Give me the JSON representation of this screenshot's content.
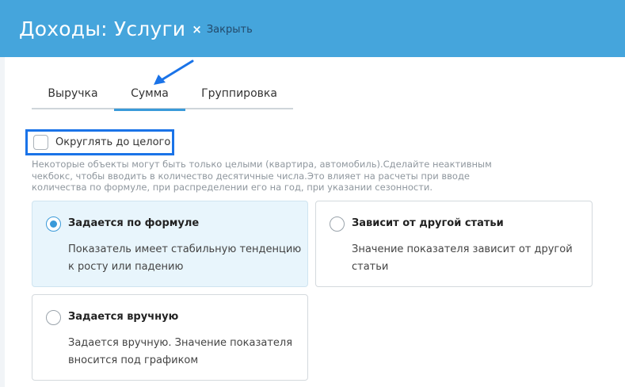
{
  "header": {
    "title": "Доходы: Услуги",
    "close_label": "Закрыть"
  },
  "tabs": [
    {
      "label": "Выручка",
      "active": false
    },
    {
      "label": "Сумма",
      "active": true
    },
    {
      "label": "Группировка",
      "active": false
    }
  ],
  "round_option": {
    "label": "Округлять до целого",
    "checked": false,
    "hint": "Некоторые объекты могут быть только целыми (квартира, автомобиль).Сделайте неактивным чекбокс, чтобы вводить в количество десятичные числа.Это влияет на расчеты при вводе количества по формуле, при распределении его на год, при указании сезонности."
  },
  "modes": [
    {
      "title": "Задается по формуле",
      "desc": "Показатель имеет стабильную тенденцию к росту или падению",
      "selected": true
    },
    {
      "title": "Зависит от другой статьи",
      "desc": "Значение показателя зависит от другой статьи",
      "selected": false
    },
    {
      "title": "Задается вручную",
      "desc": "Задается вручную. Значение показателя вносится под графиком",
      "selected": false
    }
  ],
  "colors": {
    "header_bg": "#45a5dc",
    "accent": "#3a9ad9",
    "highlight_box": "#1a73e8",
    "selected_card_bg": "#e8f5fc"
  }
}
